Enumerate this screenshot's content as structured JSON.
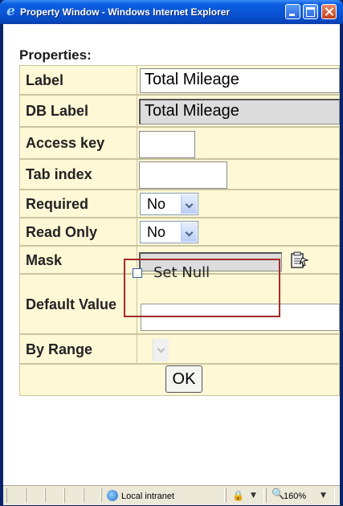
{
  "window": {
    "title": "Property Window - Windows Internet Explorer",
    "icon": "ie-logo-icon"
  },
  "form": {
    "heading": "Properties:",
    "rows": [
      {
        "label": "Label",
        "value": "Total Mileage"
      },
      {
        "label": "DB Label",
        "value": "Total Mileage"
      },
      {
        "label": "Access key",
        "value": ""
      },
      {
        "label": "Tab index",
        "value": ""
      },
      {
        "label": "Required",
        "value": "No"
      },
      {
        "label": "Read Only",
        "value": "No"
      },
      {
        "label": "Mask",
        "value": ""
      },
      {
        "label": "Default Value",
        "value": ""
      },
      {
        "label": "By Range",
        "value": ""
      }
    ],
    "set_null_label": "Set Null",
    "ok_label": "OK"
  },
  "statusbar": {
    "zone": "Local intranet",
    "zoom": "160%"
  },
  "colors": {
    "row_bg": "#fff8d6",
    "titlebar": "#0b54d6",
    "highlight_box": "#a52a2a"
  }
}
